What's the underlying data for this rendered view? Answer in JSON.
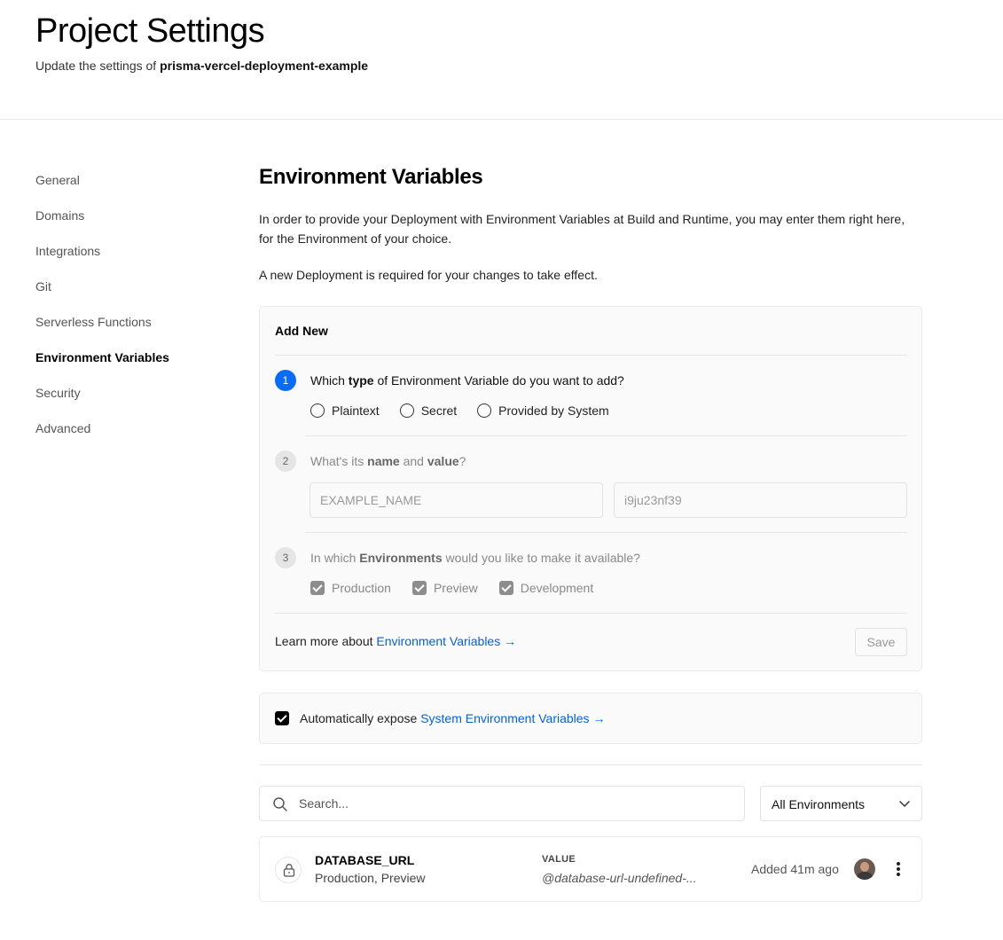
{
  "header": {
    "title": "Project Settings",
    "subtitle_prefix": "Update the settings of ",
    "project_name": "prisma-vercel-deployment-example"
  },
  "sidebar": {
    "items": [
      {
        "label": "General"
      },
      {
        "label": "Domains"
      },
      {
        "label": "Integrations"
      },
      {
        "label": "Git"
      },
      {
        "label": "Serverless Functions"
      },
      {
        "label": "Environment Variables",
        "active": true
      },
      {
        "label": "Security"
      },
      {
        "label": "Advanced"
      }
    ]
  },
  "main": {
    "title": "Environment Variables",
    "description": "In order to provide your Deployment with Environment Variables at Build and Runtime, you may enter them right here, for the Environment of your choice.",
    "note": "A new Deployment is required for your changes to take effect."
  },
  "add_new": {
    "title": "Add New",
    "step1": {
      "number": "1",
      "q_pre": "Which ",
      "q_bold": "type",
      "q_post": " of Environment Variable do you want to add?",
      "options": [
        "Plaintext",
        "Secret",
        "Provided by System"
      ]
    },
    "step2": {
      "number": "2",
      "q_pre": "What's its ",
      "q_bold1": "name",
      "q_mid": " and ",
      "q_bold2": "value",
      "q_post": "?",
      "name_placeholder": "EXAMPLE_NAME",
      "value_placeholder": "i9ju23nf39"
    },
    "step3": {
      "number": "3",
      "q_pre": "In which ",
      "q_bold": "Environments",
      "q_post": " would you like to make it available?",
      "options": [
        "Production",
        "Preview",
        "Development"
      ]
    },
    "learn_prefix": "Learn more about ",
    "learn_link": "Environment Variables →",
    "save_label": "Save"
  },
  "expose": {
    "prefix": "Automatically expose ",
    "link": "System Environment Variables →",
    "checked": true
  },
  "filters": {
    "search_placeholder": "Search...",
    "environment_select": "All Environments"
  },
  "variables": [
    {
      "name": "DATABASE_URL",
      "environments": "Production, Preview",
      "value_label": "VALUE",
      "value": "@database-url-undefined-...",
      "added": "Added 41m ago"
    }
  ],
  "colors": {
    "accent": "#0a6cf5",
    "link": "#0761d1"
  },
  "icons": [
    "search-icon",
    "chevron-down-icon",
    "lock-icon",
    "more-vertical-icon",
    "avatar"
  ]
}
